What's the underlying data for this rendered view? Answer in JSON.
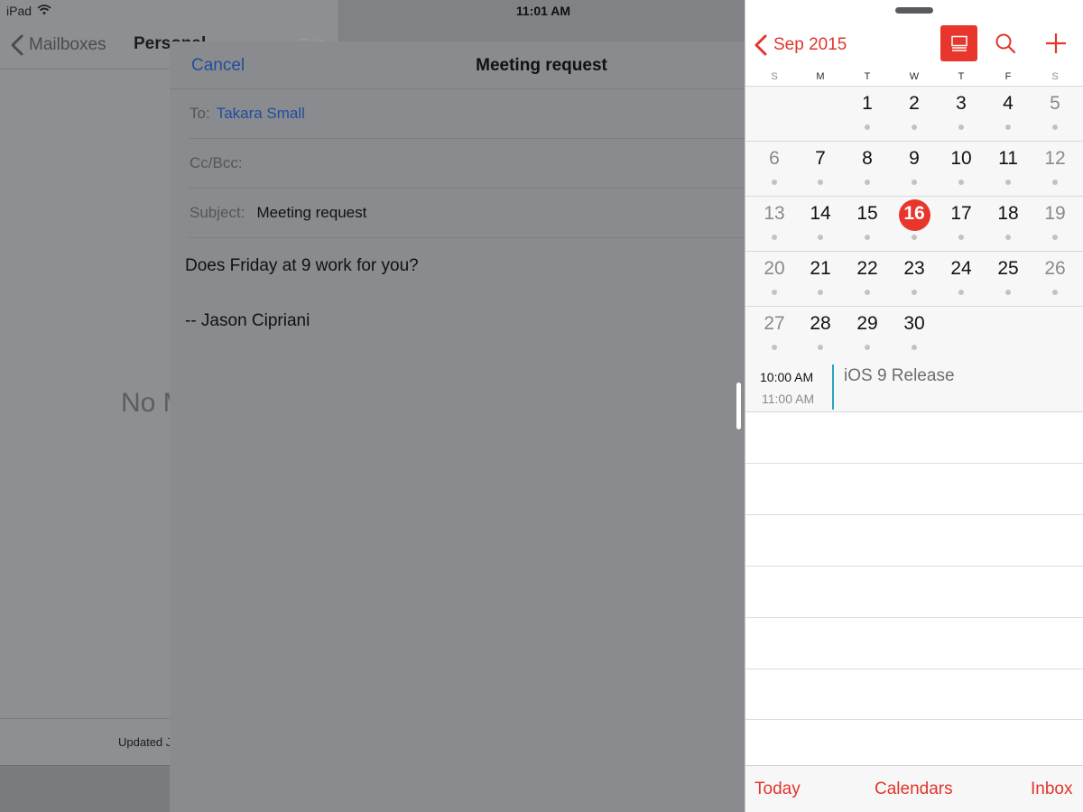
{
  "status_bar": {
    "device": "iPad",
    "time": "11:01 AM"
  },
  "mail": {
    "back_label": "Mailboxes",
    "mailbox_title": "Personal",
    "edit_label": "Edit",
    "empty_label": "No Mail",
    "updated_label": "Updated Just Now"
  },
  "compose": {
    "cancel_label": "Cancel",
    "title": "Meeting request",
    "to_label": "To:",
    "to_value": "Takara Small",
    "cc_label": "Cc/Bcc:",
    "subject_label": "Subject:",
    "subject_value": "Meeting request",
    "body_line1": "Does Friday at 9 work for you?",
    "body_line2": "-- Jason Cipriani"
  },
  "calendar": {
    "month_label": "Sep 2015",
    "weekdays": [
      "S",
      "M",
      "T",
      "W",
      "T",
      "F",
      "S"
    ],
    "weeks": [
      [
        "",
        "",
        "1",
        "2",
        "3",
        "4",
        "5"
      ],
      [
        "6",
        "7",
        "8",
        "9",
        "10",
        "11",
        "12"
      ],
      [
        "13",
        "14",
        "15",
        "16",
        "17",
        "18",
        "19"
      ],
      [
        "20",
        "21",
        "22",
        "23",
        "24",
        "25",
        "26"
      ],
      [
        "27",
        "28",
        "29",
        "30",
        "",
        "",
        ""
      ]
    ],
    "today": "16",
    "event": {
      "start": "10:00 AM",
      "end": "11:00 AM",
      "title": "iOS 9 Release"
    },
    "toolbar": {
      "today": "Today",
      "calendars": "Calendars",
      "inbox": "Inbox"
    },
    "accent_color": "#e8362c",
    "event_color": "#27a6c3"
  }
}
